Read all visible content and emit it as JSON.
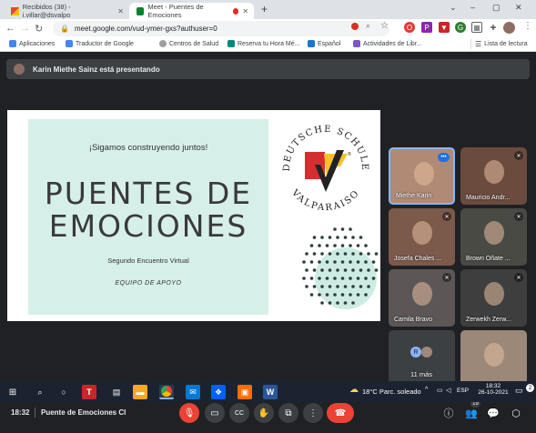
{
  "browser": {
    "tabs": [
      {
        "title": "Recibidos (38) - i.villar@dsvalpo"
      },
      {
        "title": "Meet - Puentes de Emociones"
      }
    ],
    "url": "meet.google.com/vud-ymer-gxs?authuser=0",
    "bookmarks": [
      {
        "label": "Aplicaciones",
        "color": "#4285f4"
      },
      {
        "label": "Traductor de Google",
        "color": "#4285f4"
      },
      {
        "label": "Centros de Salud",
        "color": "#9e9e9e"
      },
      {
        "label": "Reserva tu Hora Mé...",
        "color": "#00897b"
      },
      {
        "label": "Español",
        "color": "#1976d2"
      },
      {
        "label": "Actividades de Libr...",
        "color": "#7e57c2"
      }
    ],
    "reading_list": "Lista de lectura"
  },
  "meet": {
    "presenter_notice": "Karin Miethe Sainz está presentando",
    "slide": {
      "tagline": "¡Sigamos construyendo juntos!",
      "title_line1": "PUENTES DE",
      "title_line2": "EMOCIONES",
      "subtitle": "Segundo Encuentro Virtual",
      "team": "EQUIPO DE APOYO",
      "logo_top": "DEUTSCHE SCHULE",
      "logo_bottom": "VALPARAISO",
      "logo_letters": "DS"
    },
    "participants": [
      {
        "name": "Miethe Karin",
        "bg": "#b08a74"
      },
      {
        "name": "Mauricio Andr...",
        "bg": "#6b4b3e"
      },
      {
        "name": "Josefa Chales ...",
        "bg": "#7b5a4c"
      },
      {
        "name": "Brown Oñate ...",
        "bg": "#4a4a44"
      },
      {
        "name": "Camila Bravo",
        "bg": "#5c5656"
      },
      {
        "name": "Zerwekh Zerw...",
        "bg": "#3e3e3e"
      },
      {
        "name": "11 más",
        "bg": "#3c4043"
      },
      {
        "name": "",
        "bg": "#9c8878"
      }
    ],
    "more_avatar_letter": "R",
    "time": "18:32",
    "meeting_name": "Puente de Emociones CI",
    "participant_count": "19"
  },
  "taskbar": {
    "weather": "18°C  Parc. soleado",
    "lang": "ESP",
    "clock_time": "18:32",
    "clock_date": "26-10-2021",
    "notif_count": "2"
  }
}
